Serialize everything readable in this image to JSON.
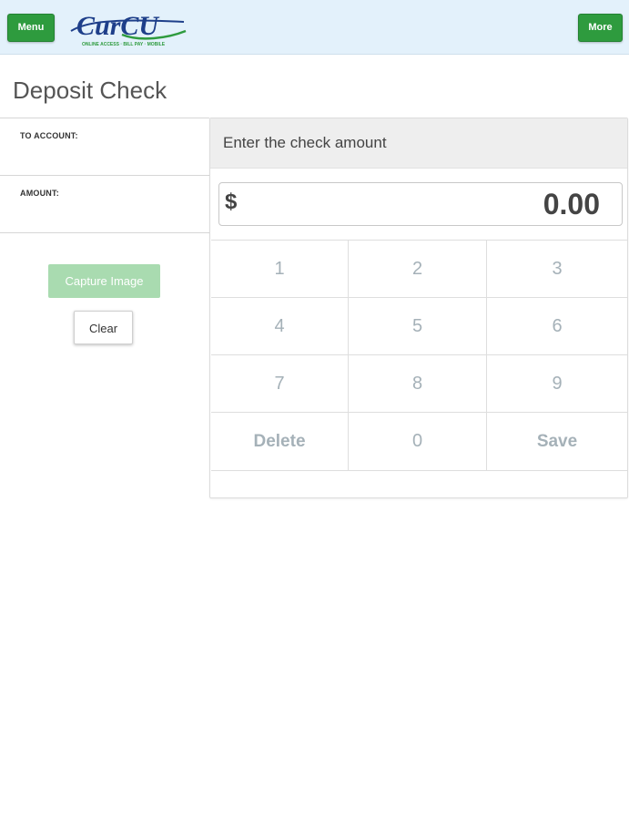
{
  "header": {
    "menu_label": "Menu",
    "more_label": "More",
    "logo": {
      "name": "CurCU",
      "tagline": "ONLINE ACCESS · BILL PAY · MOBILE",
      "colors": {
        "primary": "#1e3f8a",
        "accent": "#2e9b3e"
      }
    }
  },
  "page": {
    "title": "Deposit Check"
  },
  "form": {
    "to_account_label": "TO ACCOUNT:",
    "amount_label": "AMOUNT:",
    "capture_label": "Capture Image",
    "clear_label": "Clear"
  },
  "keypad": {
    "prompt": "Enter the check amount",
    "currency": "$",
    "amount": "0.00",
    "keys": [
      "1",
      "2",
      "3",
      "4",
      "5",
      "6",
      "7",
      "8",
      "9",
      "Delete",
      "0",
      "Save"
    ]
  },
  "colors": {
    "header_bg": "#e3f1fb",
    "button_green": "#2e9b3e",
    "capture_disabled": "#a9dbb0",
    "key_text": "#a5b1b8"
  }
}
